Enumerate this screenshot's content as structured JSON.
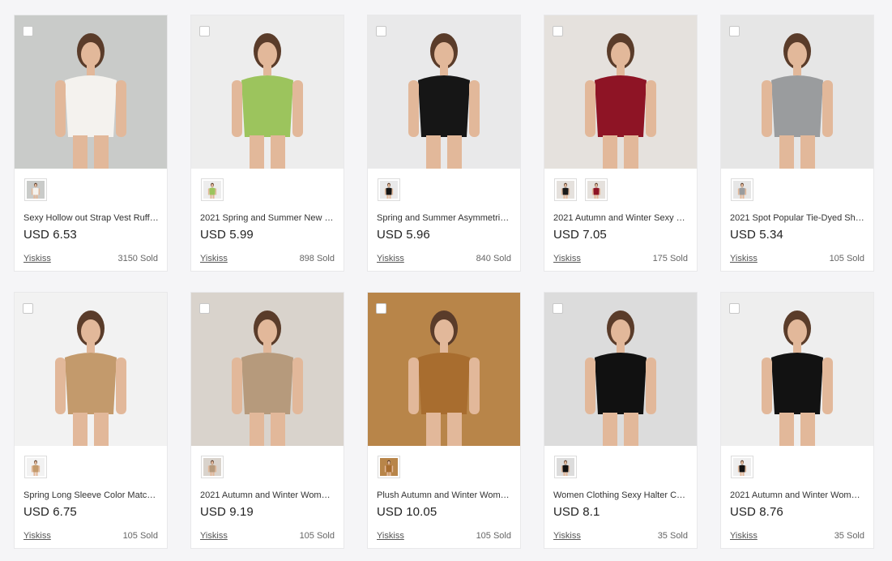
{
  "products": [
    {
      "title": "Sexy Hollow out Strap Vest Ruff…",
      "price": "USD 6.53",
      "seller": "Yiskiss",
      "sold": "3150 Sold",
      "bg": "#c9cbc9",
      "accent": "#f4f2ee",
      "swatches": [
        "#f4f2ee"
      ]
    },
    {
      "title": "2021 Spring and Summer New …",
      "price": "USD 5.99",
      "seller": "Yiskiss",
      "sold": "898 Sold",
      "bg": "#ededed",
      "accent": "#9cc45d",
      "swatches": [
        "#9cc45d"
      ]
    },
    {
      "title": "Spring and Summer Asymmetri…",
      "price": "USD 5.96",
      "seller": "Yiskiss",
      "sold": "840 Sold",
      "bg": "#e9e9ea",
      "accent": "#161616",
      "swatches": [
        "#161616"
      ]
    },
    {
      "title": "2021 Autumn and Winter Sexy …",
      "price": "USD 7.05",
      "seller": "Yiskiss",
      "sold": "175 Sold",
      "bg": "#e5e1dd",
      "accent": "#8e1425",
      "swatches": [
        "#1a1a1a",
        "#8e1425"
      ]
    },
    {
      "title": "2021 Spot Popular Tie-Dyed Sh…",
      "price": "USD 5.34",
      "seller": "Yiskiss",
      "sold": "105 Sold",
      "bg": "#e6e6e6",
      "accent": "#9a9c9e",
      "swatches": [
        "#9a9c9e"
      ]
    },
    {
      "title": "Spring Long Sleeve Color Matc…",
      "price": "USD 6.75",
      "seller": "Yiskiss",
      "sold": "105 Sold",
      "bg": "#f2f2f2",
      "accent": "#c39a6c",
      "swatches": [
        "#c39a6c"
      ]
    },
    {
      "title": "2021 Autumn and Winter Wom…",
      "price": "USD 9.19",
      "seller": "Yiskiss",
      "sold": "105 Sold",
      "bg": "#d9d3cc",
      "accent": "#b69a7c",
      "swatches": [
        "#b69a7c"
      ]
    },
    {
      "title": "Plush Autumn and Winter Wom…",
      "price": "USD 10.05",
      "seller": "Yiskiss",
      "sold": "105 Sold",
      "bg": "#b88549",
      "accent": "#a86d2f",
      "swatches": [
        "#a86d2f"
      ]
    },
    {
      "title": "Women Clothing Sexy Halter C…",
      "price": "USD 8.1",
      "seller": "Yiskiss",
      "sold": "35 Sold",
      "bg": "#dcdcdc",
      "accent": "#111111",
      "swatches": [
        "#111111"
      ]
    },
    {
      "title": "2021 Autumn and Winter Wom…",
      "price": "USD 8.76",
      "seller": "Yiskiss",
      "sold": "35 Sold",
      "bg": "#eeeeee",
      "accent": "#121212",
      "swatches": [
        "#121212"
      ]
    }
  ]
}
